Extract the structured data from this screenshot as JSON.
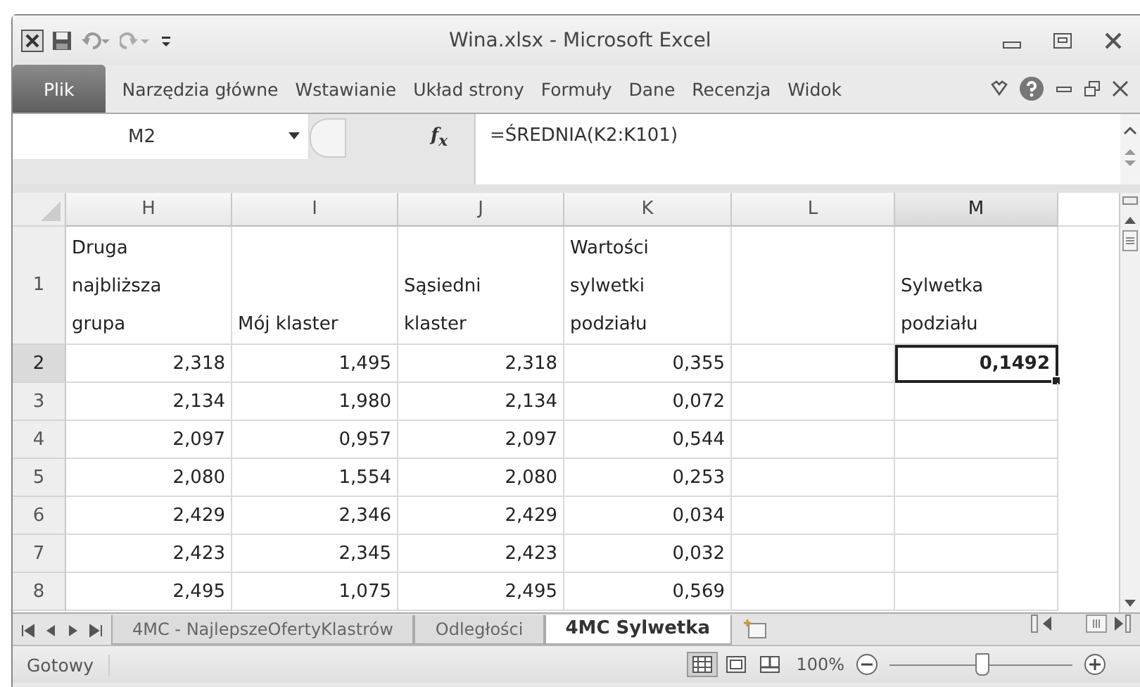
{
  "window": {
    "title": "Wina.xlsx  -  Microsoft Excel"
  },
  "ribbon_tabs": [
    {
      "label": "Plik",
      "kind": "file",
      "selected": false
    },
    {
      "label": "Narzędzia główne",
      "kind": "tab",
      "selected": false
    },
    {
      "label": "Wstawianie",
      "kind": "tab",
      "selected": false
    },
    {
      "label": "Układ strony",
      "kind": "tab",
      "selected": false
    },
    {
      "label": "Formuły",
      "kind": "tab",
      "selected": false
    },
    {
      "label": "Dane",
      "kind": "tab",
      "selected": false
    },
    {
      "label": "Recenzja",
      "kind": "tab",
      "selected": false
    },
    {
      "label": "Widok",
      "kind": "tab",
      "selected": false
    }
  ],
  "name_box": "M2",
  "function_label": "f$_{x}$",
  "formula": "=ŚREDNIA(K2:K101)",
  "columns": [
    {
      "label": "H",
      "selected": false
    },
    {
      "label": "I",
      "selected": false
    },
    {
      "label": "J",
      "selected": false
    },
    {
      "label": "K",
      "selected": false
    },
    {
      "label": "L",
      "selected": false
    },
    {
      "label": "M",
      "selected": true
    }
  ],
  "rows": [
    {
      "number": "1",
      "selected": false,
      "cells": [
        {
          "text": "Druga\nnajbliższa\ngrupa"
        },
        {
          "text": "Mój klaster"
        },
        {
          "text": "Sąsiedni\nklaster"
        },
        {
          "text": "Wartości\nsylwetki\npodziału"
        },
        {
          "text": ""
        },
        {
          "text": "Sylwetka\npodziału"
        }
      ]
    },
    {
      "number": "2",
      "selected": true,
      "cells": [
        {
          "text": "2,318"
        },
        {
          "text": "1,495"
        },
        {
          "text": "2,318"
        },
        {
          "text": "0,355"
        },
        {
          "text": ""
        },
        {
          "text": "0,1492",
          "active": true
        }
      ]
    },
    {
      "number": "3",
      "selected": false,
      "cells": [
        {
          "text": "2,134"
        },
        {
          "text": "1,980"
        },
        {
          "text": "2,134"
        },
        {
          "text": "0,072"
        },
        {
          "text": ""
        },
        {
          "text": ""
        }
      ]
    },
    {
      "number": "4",
      "selected": false,
      "cells": [
        {
          "text": "2,097"
        },
        {
          "text": "0,957"
        },
        {
          "text": "2,097"
        },
        {
          "text": "0,544"
        },
        {
          "text": ""
        },
        {
          "text": ""
        }
      ]
    },
    {
      "number": "5",
      "selected": false,
      "cells": [
        {
          "text": "2,080"
        },
        {
          "text": "1,554"
        },
        {
          "text": "2,080"
        },
        {
          "text": "0,253"
        },
        {
          "text": ""
        },
        {
          "text": ""
        }
      ]
    },
    {
      "number": "6",
      "selected": false,
      "cells": [
        {
          "text": "2,429"
        },
        {
          "text": "2,346"
        },
        {
          "text": "2,429"
        },
        {
          "text": "0,034"
        },
        {
          "text": ""
        },
        {
          "text": ""
        }
      ]
    },
    {
      "number": "7",
      "selected": false,
      "cells": [
        {
          "text": "2,423"
        },
        {
          "text": "2,345"
        },
        {
          "text": "2,423"
        },
        {
          "text": "0,032"
        },
        {
          "text": ""
        },
        {
          "text": ""
        }
      ]
    },
    {
      "number": "8",
      "selected": false,
      "cells": [
        {
          "text": "2,495"
        },
        {
          "text": "1,075"
        },
        {
          "text": "2,495"
        },
        {
          "text": "0,569"
        },
        {
          "text": ""
        },
        {
          "text": ""
        }
      ]
    }
  ],
  "sheet_tabs": [
    {
      "label": "4MC - NajlepszeOfertyKlastrów",
      "selected": false
    },
    {
      "label": "Odległości",
      "selected": false
    },
    {
      "label": "4MC Sylwetka",
      "selected": true
    }
  ],
  "status_bar": {
    "status": "Gotowy",
    "zoom": "100%",
    "zoom_level": {
      "level": 0.5
    },
    "views": [
      {
        "kind": "normal",
        "selected": true
      },
      {
        "kind": "layout",
        "selected": false
      },
      {
        "kind": "break",
        "selected": false
      }
    ]
  }
}
